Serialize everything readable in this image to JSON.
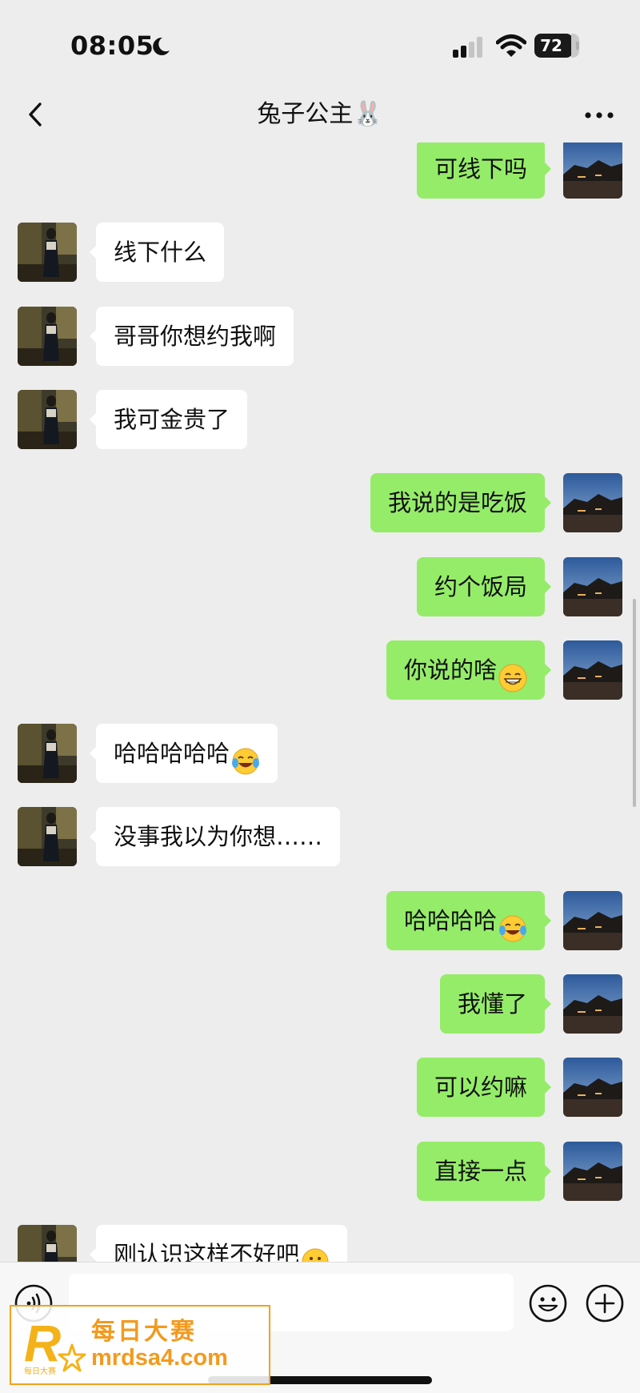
{
  "status_bar": {
    "time": "08:05",
    "battery": "72"
  },
  "header": {
    "title": "兔子公主🐰"
  },
  "messages": [
    {
      "side": "out",
      "text": "可线下吗"
    },
    {
      "side": "in",
      "text": "线下什么"
    },
    {
      "side": "in",
      "text": "哥哥你想约我啊"
    },
    {
      "side": "in",
      "text": "我可金贵了"
    },
    {
      "side": "out",
      "text": "我说的是吃饭"
    },
    {
      "side": "out",
      "text": "约个饭局"
    },
    {
      "side": "out",
      "text": "你说的啥",
      "emoji": "grin-icon"
    },
    {
      "side": "in",
      "text": "哈哈哈哈哈",
      "emoji": "tears-of-joy-icon"
    },
    {
      "side": "in",
      "text": "没事我以为你想……"
    },
    {
      "side": "out",
      "text": "哈哈哈哈",
      "emoji": "tears-of-joy-icon"
    },
    {
      "side": "out",
      "text": "我懂了"
    },
    {
      "side": "out",
      "text": "可以约嘛"
    },
    {
      "side": "out",
      "text": "直接一点"
    },
    {
      "side": "in",
      "text": "刚认识这样不好吧",
      "emoji": "thinking-face-icon"
    }
  ],
  "input": {
    "placeholder": ""
  },
  "watermark": {
    "logo_letter": "R",
    "small_text": "每日大赛",
    "title": "每日大赛",
    "url": "mrdsa4.com"
  },
  "colors": {
    "outgoing_bubble": "#95ec69",
    "incoming_bubble": "#ffffff",
    "background": "#ededed"
  }
}
